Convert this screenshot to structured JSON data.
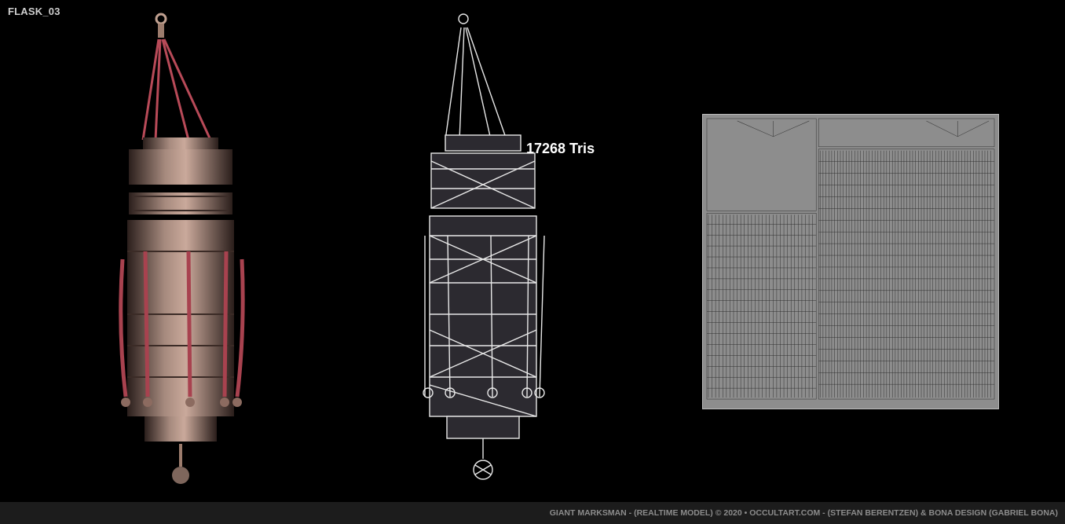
{
  "header": {
    "title": "FLASK_03"
  },
  "viewport": {
    "render_label": "",
    "tri_count": "17268 Tris"
  },
  "uv_sheet": {
    "label": ""
  },
  "footer": {
    "credits": "GIANT MARKSMAN - (REALTIME MODEL) © 2020   •   OCCULTART.COM - (STEFAN BERENTZEN)  &  BONA DESIGN (GABRIEL BONA)"
  },
  "colors": {
    "background": "#000000",
    "footer_bg": "#1c1c1c",
    "metal": "#8a6f63",
    "rope": "#a8424f",
    "uv_bg": "#8d8d8d"
  }
}
